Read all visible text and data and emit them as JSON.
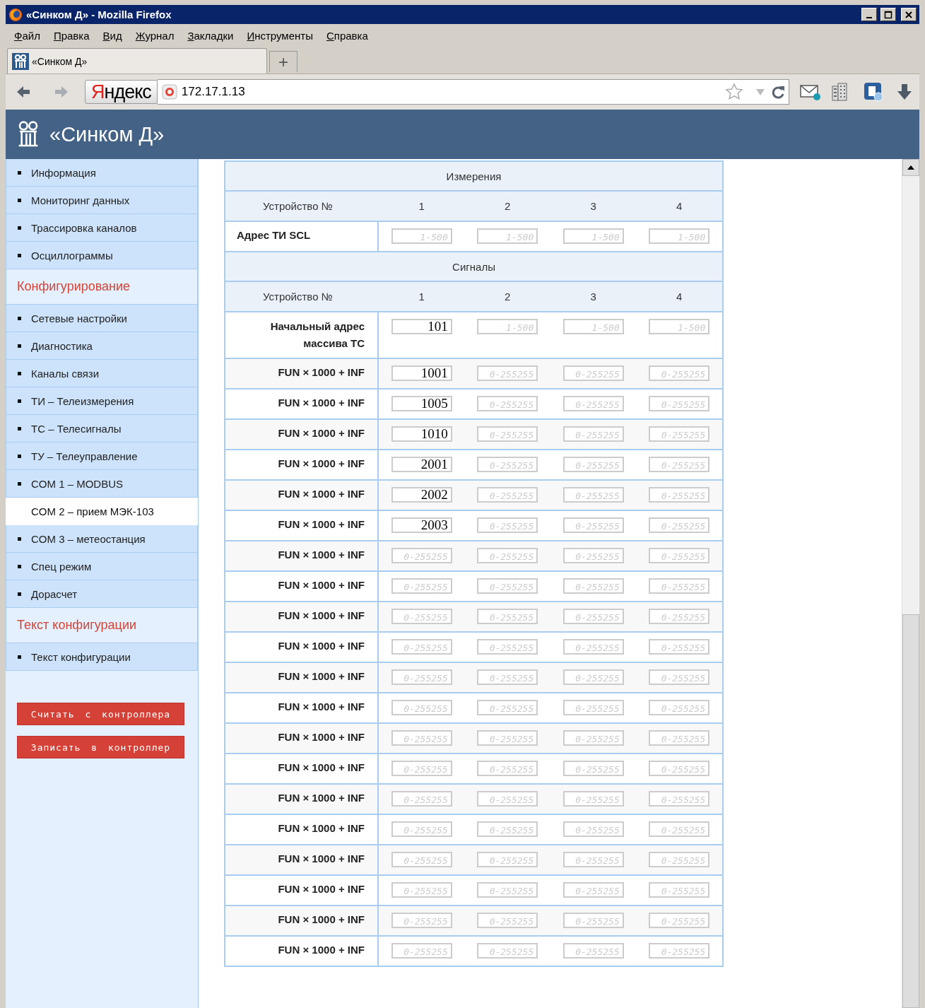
{
  "window": {
    "title": "«Синком Д» - Mozilla Firefox"
  },
  "menu": [
    "Файл",
    "Правка",
    "Вид",
    "Журнал",
    "Закладки",
    "Инструменты",
    "Справка"
  ],
  "tabs": [
    {
      "label": "«Синком Д»",
      "selected": true
    }
  ],
  "new_tab": "+",
  "navigation": {
    "search_engine": "Яндекс",
    "address": "172.17.1.13"
  },
  "app_header": {
    "title": "«Синком Д»"
  },
  "sidebar": {
    "items": [
      {
        "kind": "item",
        "label": "Информация",
        "selected": false
      },
      {
        "kind": "item",
        "label": "Мониторинг данных",
        "selected": false
      },
      {
        "kind": "item",
        "label": "Трассировка каналов",
        "selected": false
      },
      {
        "kind": "item",
        "label": "Осциллограммы",
        "selected": false
      },
      {
        "kind": "heading",
        "label": "Конфигурирование"
      },
      {
        "kind": "item",
        "label": "Сетевые настройки",
        "selected": false
      },
      {
        "kind": "item",
        "label": "Диагностика",
        "selected": false
      },
      {
        "kind": "item",
        "label": "Каналы связи",
        "selected": false
      },
      {
        "kind": "item",
        "label": "ТИ – Телеизмерения",
        "selected": false
      },
      {
        "kind": "item",
        "label": "ТС – Телесигналы",
        "selected": false
      },
      {
        "kind": "item",
        "label": "ТУ – Телеуправление",
        "selected": false
      },
      {
        "kind": "item",
        "label": "COM 1 – MODBUS",
        "selected": false
      },
      {
        "kind": "item",
        "label": "COM 2 – прием МЭК-103",
        "selected": true
      },
      {
        "kind": "item",
        "label": "COM 3 – метеостанция",
        "selected": false
      },
      {
        "kind": "item",
        "label": "Спец режим",
        "selected": false
      },
      {
        "kind": "item",
        "label": "Дорасчет",
        "selected": false
      },
      {
        "kind": "heading",
        "label": "Текст конфигурации"
      },
      {
        "kind": "item",
        "label": "Текст конфигурации",
        "selected": false
      }
    ],
    "buttons": [
      "Считать с контроллера",
      "Записать в контроллер"
    ]
  },
  "table": {
    "rows": [
      {
        "kind": "section",
        "title": "Измерения"
      },
      {
        "kind": "devices",
        "label": "Устройство №",
        "columns": [
          "1",
          "2",
          "3",
          "4"
        ]
      },
      {
        "kind": "address",
        "label": "Адрес ТИ SCL",
        "fields": [
          {
            "placeholder": "1-500"
          },
          {
            "placeholder": "1-500"
          },
          {
            "placeholder": "1-500"
          },
          {
            "placeholder": "1-500"
          }
        ]
      },
      {
        "kind": "section",
        "title": "Сигналы"
      },
      {
        "kind": "devices",
        "label": "Устройство №",
        "columns": [
          "1",
          "2",
          "3",
          "4"
        ]
      },
      {
        "kind": "start",
        "label": "Начальный адрес массива ТС",
        "fields": [
          {
            "value": "101"
          },
          {
            "placeholder": "1-500"
          },
          {
            "placeholder": "1-500"
          },
          {
            "placeholder": "1-500"
          }
        ]
      },
      {
        "kind": "fun",
        "label": "FUN × 1000 + INF",
        "fields": [
          {
            "value": "1001"
          },
          {
            "placeholder": "0-255255"
          },
          {
            "placeholder": "0-255255"
          },
          {
            "placeholder": "0-255255"
          }
        ]
      },
      {
        "kind": "fun",
        "label": "FUN × 1000 + INF",
        "fields": [
          {
            "value": "1005"
          },
          {
            "placeholder": "0-255255"
          },
          {
            "placeholder": "0-255255"
          },
          {
            "placeholder": "0-255255"
          }
        ]
      },
      {
        "kind": "fun",
        "label": "FUN × 1000 + INF",
        "fields": [
          {
            "value": "1010"
          },
          {
            "placeholder": "0-255255"
          },
          {
            "placeholder": "0-255255"
          },
          {
            "placeholder": "0-255255"
          }
        ]
      },
      {
        "kind": "fun",
        "label": "FUN × 1000 + INF",
        "fields": [
          {
            "value": "2001"
          },
          {
            "placeholder": "0-255255"
          },
          {
            "placeholder": "0-255255"
          },
          {
            "placeholder": "0-255255"
          }
        ]
      },
      {
        "kind": "fun",
        "label": "FUN × 1000 + INF",
        "fields": [
          {
            "value": "2002"
          },
          {
            "placeholder": "0-255255"
          },
          {
            "placeholder": "0-255255"
          },
          {
            "placeholder": "0-255255"
          }
        ]
      },
      {
        "kind": "fun",
        "label": "FUN × 1000 + INF",
        "fields": [
          {
            "value": "2003"
          },
          {
            "placeholder": "0-255255"
          },
          {
            "placeholder": "0-255255"
          },
          {
            "placeholder": "0-255255"
          }
        ]
      },
      {
        "kind": "fun",
        "label": "FUN × 1000 + INF",
        "fields": [
          {
            "placeholder": "0-255255"
          },
          {
            "placeholder": "0-255255"
          },
          {
            "placeholder": "0-255255"
          },
          {
            "placeholder": "0-255255"
          }
        ]
      },
      {
        "kind": "fun",
        "label": "FUN × 1000 + INF",
        "fields": [
          {
            "placeholder": "0-255255"
          },
          {
            "placeholder": "0-255255"
          },
          {
            "placeholder": "0-255255"
          },
          {
            "placeholder": "0-255255"
          }
        ]
      },
      {
        "kind": "fun",
        "label": "FUN × 1000 + INF",
        "fields": [
          {
            "placeholder": "0-255255"
          },
          {
            "placeholder": "0-255255"
          },
          {
            "placeholder": "0-255255"
          },
          {
            "placeholder": "0-255255"
          }
        ]
      },
      {
        "kind": "fun",
        "label": "FUN × 1000 + INF",
        "fields": [
          {
            "placeholder": "0-255255"
          },
          {
            "placeholder": "0-255255"
          },
          {
            "placeholder": "0-255255"
          },
          {
            "placeholder": "0-255255"
          }
        ]
      },
      {
        "kind": "fun",
        "label": "FUN × 1000 + INF",
        "fields": [
          {
            "placeholder": "0-255255"
          },
          {
            "placeholder": "0-255255"
          },
          {
            "placeholder": "0-255255"
          },
          {
            "placeholder": "0-255255"
          }
        ]
      },
      {
        "kind": "fun",
        "label": "FUN × 1000 + INF",
        "fields": [
          {
            "placeholder": "0-255255"
          },
          {
            "placeholder": "0-255255"
          },
          {
            "placeholder": "0-255255"
          },
          {
            "placeholder": "0-255255"
          }
        ]
      },
      {
        "kind": "fun",
        "label": "FUN × 1000 + INF",
        "fields": [
          {
            "placeholder": "0-255255"
          },
          {
            "placeholder": "0-255255"
          },
          {
            "placeholder": "0-255255"
          },
          {
            "placeholder": "0-255255"
          }
        ]
      },
      {
        "kind": "fun",
        "label": "FUN × 1000 + INF",
        "fields": [
          {
            "placeholder": "0-255255"
          },
          {
            "placeholder": "0-255255"
          },
          {
            "placeholder": "0-255255"
          },
          {
            "placeholder": "0-255255"
          }
        ]
      },
      {
        "kind": "fun",
        "label": "FUN × 1000 + INF",
        "fields": [
          {
            "placeholder": "0-255255"
          },
          {
            "placeholder": "0-255255"
          },
          {
            "placeholder": "0-255255"
          },
          {
            "placeholder": "0-255255"
          }
        ]
      },
      {
        "kind": "fun",
        "label": "FUN × 1000 + INF",
        "fields": [
          {
            "placeholder": "0-255255"
          },
          {
            "placeholder": "0-255255"
          },
          {
            "placeholder": "0-255255"
          },
          {
            "placeholder": "0-255255"
          }
        ]
      },
      {
        "kind": "fun",
        "label": "FUN × 1000 + INF",
        "fields": [
          {
            "placeholder": "0-255255"
          },
          {
            "placeholder": "0-255255"
          },
          {
            "placeholder": "0-255255"
          },
          {
            "placeholder": "0-255255"
          }
        ]
      },
      {
        "kind": "fun",
        "label": "FUN × 1000 + INF",
        "fields": [
          {
            "placeholder": "0-255255"
          },
          {
            "placeholder": "0-255255"
          },
          {
            "placeholder": "0-255255"
          },
          {
            "placeholder": "0-255255"
          }
        ]
      },
      {
        "kind": "fun",
        "label": "FUN × 1000 + INF",
        "fields": [
          {
            "placeholder": "0-255255"
          },
          {
            "placeholder": "0-255255"
          },
          {
            "placeholder": "0-255255"
          },
          {
            "placeholder": "0-255255"
          }
        ]
      },
      {
        "kind": "fun",
        "label": "FUN × 1000 + INF",
        "fields": [
          {
            "placeholder": "0-255255"
          },
          {
            "placeholder": "0-255255"
          },
          {
            "placeholder": "0-255255"
          },
          {
            "placeholder": "0-255255"
          }
        ]
      }
    ]
  }
}
